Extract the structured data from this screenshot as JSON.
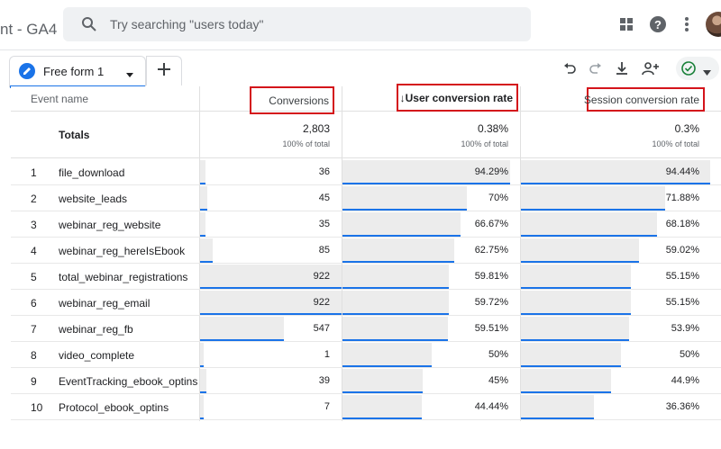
{
  "app": {
    "title": "nt - GA4"
  },
  "search": {
    "placeholder": "Try searching \"users today\""
  },
  "icons": {
    "apps": "apps-grid-icon",
    "help": "help-icon",
    "more": "more-vert-icon",
    "search": "search-icon"
  },
  "tabs": [
    {
      "label": "Free form 1"
    }
  ],
  "toolbar": {
    "status": "check-circle-icon"
  },
  "colors": {
    "accent": "#1a73e8",
    "highlight_box": "#d4141b",
    "bar_fill": "#ececec",
    "status_green": "#188038"
  },
  "table": {
    "headers": {
      "event_name": "Event name",
      "conversions": "Conversions",
      "user_conversion_rate": "↓User conversion rate",
      "session_conversion_rate": "Session conversion rate"
    },
    "totals": {
      "label": "Totals",
      "conversions": "2,803",
      "conversions_sub": "100% of total",
      "user_conversion_rate": "0.38%",
      "user_conversion_rate_sub": "100% of total",
      "session_conversion_rate": "0.3%",
      "session_conversion_rate_sub": "100% of total"
    },
    "rows": [
      {
        "index": "1",
        "event": "file_download",
        "conversions": "36",
        "ucr": "94.29%",
        "scr": "94.44%",
        "conv_num": 36,
        "ucr_num": 94.29,
        "scr_num": 94.44
      },
      {
        "index": "2",
        "event": "website_leads",
        "conversions": "45",
        "ucr": "70%",
        "scr": "71.88%",
        "conv_num": 45,
        "ucr_num": 70,
        "scr_num": 71.88
      },
      {
        "index": "3",
        "event": "webinar_reg_website",
        "conversions": "35",
        "ucr": "66.67%",
        "scr": "68.18%",
        "conv_num": 35,
        "ucr_num": 66.67,
        "scr_num": 68.18
      },
      {
        "index": "4",
        "event": "webinar_reg_hereIsEbook",
        "conversions": "85",
        "ucr": "62.75%",
        "scr": "59.02%",
        "conv_num": 85,
        "ucr_num": 62.75,
        "scr_num": 59.02
      },
      {
        "index": "5",
        "event": "total_webinar_registrations",
        "conversions": "922",
        "ucr": "59.81%",
        "scr": "55.15%",
        "conv_num": 922,
        "ucr_num": 59.81,
        "scr_num": 55.15
      },
      {
        "index": "6",
        "event": "webinar_reg_email",
        "conversions": "922",
        "ucr": "59.72%",
        "scr": "55.15%",
        "conv_num": 922,
        "ucr_num": 59.72,
        "scr_num": 55.15
      },
      {
        "index": "7",
        "event": "webinar_reg_fb",
        "conversions": "547",
        "ucr": "59.51%",
        "scr": "53.9%",
        "conv_num": 547,
        "ucr_num": 59.51,
        "scr_num": 53.9
      },
      {
        "index": "8",
        "event": "video_complete",
        "conversions": "1",
        "ucr": "50%",
        "scr": "50%",
        "conv_num": 1,
        "ucr_num": 50,
        "scr_num": 50
      },
      {
        "index": "9",
        "event": "EventTracking_ebook_optins",
        "conversions": "39",
        "ucr": "45%",
        "scr": "44.9%",
        "conv_num": 39,
        "ucr_num": 45,
        "scr_num": 44.9
      },
      {
        "index": "10",
        "event": "Protocol_ebook_optins",
        "conversions": "7",
        "ucr": "44.44%",
        "scr": "36.36%",
        "conv_num": 7,
        "ucr_num": 44.44,
        "scr_num": 36.36
      }
    ]
  }
}
